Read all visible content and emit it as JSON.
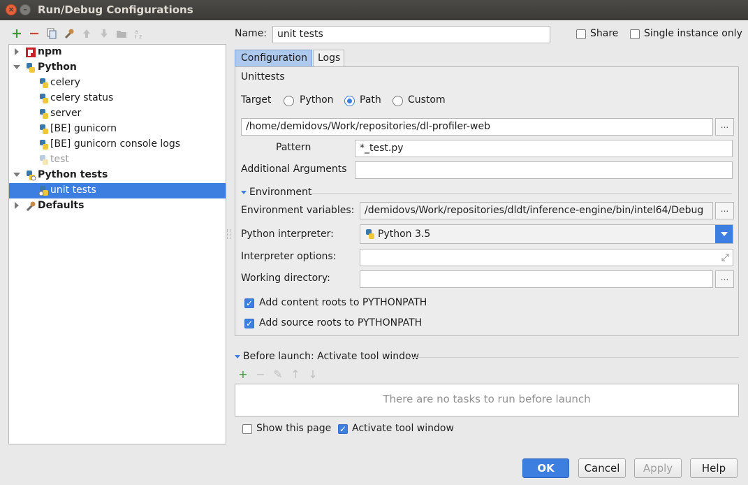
{
  "window": {
    "title": "Run/Debug Configurations"
  },
  "toolbar": {
    "icons": [
      "add-icon",
      "remove-icon",
      "copy-icon",
      "wrench-icon",
      "move-up-icon",
      "move-down-icon",
      "folder-icon",
      "sort-icon"
    ]
  },
  "tree": {
    "items": [
      {
        "label": "npm",
        "icon": "npm-icon",
        "bold": true
      },
      {
        "label": "Python",
        "icon": "python-icon",
        "bold": true
      },
      {
        "label": "celery",
        "icon": "python-icon"
      },
      {
        "label": "celery status",
        "icon": "python-icon"
      },
      {
        "label": "server",
        "icon": "python-icon"
      },
      {
        "label": "[BE] gunicorn",
        "icon": "python-icon"
      },
      {
        "label": "[BE] gunicorn console logs",
        "icon": "python-icon"
      },
      {
        "label": "test",
        "icon": "python-icon",
        "faded": true
      },
      {
        "label": "Python tests",
        "icon": "python-tests-icon",
        "bold": true
      },
      {
        "label": "unit tests",
        "icon": "python-tests-icon",
        "selected": true
      },
      {
        "label": "Defaults",
        "icon": "wrench-icon",
        "bold": true
      }
    ]
  },
  "form": {
    "name_label": "Name:",
    "name_value": "unit tests",
    "share_label": "Share",
    "single_instance_label": "Single instance only"
  },
  "tabs": [
    {
      "label": "Configuration"
    },
    {
      "label": "Logs"
    }
  ],
  "config": {
    "section_title": "Unittests",
    "target_label": "Target",
    "target_options": [
      "Python",
      "Path",
      "Custom"
    ],
    "target_selected": "Path",
    "path_value": "/home/demidovs/Work/repositories/dl-profiler-web",
    "pattern_label": "Pattern",
    "pattern_value": "*_test.py",
    "additional_args_label": "Additional Arguments",
    "additional_args_value": "",
    "environment_header": "Environment",
    "env_vars_label": "Environment variables:",
    "env_vars_value": "/demidovs/Work/repositories/dldt/inference-engine/bin/intel64/Debug",
    "interpreter_label": "Python interpreter:",
    "interpreter_value": "Python 3.5",
    "interp_options_label": "Interpreter options:",
    "interp_options_value": "",
    "working_dir_label": "Working directory:",
    "working_dir_value": "",
    "content_roots_label": "Add content roots to PYTHONPATH",
    "source_roots_label": "Add source roots to PYTHONPATH",
    "ellipsis": "..."
  },
  "before_launch": {
    "header": "Before launch: Activate tool window",
    "empty_text": "There are no tasks to run before launch",
    "show_page_label": "Show this page",
    "activate_tool_label": "Activate tool window",
    "mini_icons": [
      "+",
      "−",
      "✎",
      "↑",
      "↓"
    ]
  },
  "buttons": {
    "ok": "OK",
    "cancel": "Cancel",
    "apply": "Apply",
    "help": "Help"
  }
}
